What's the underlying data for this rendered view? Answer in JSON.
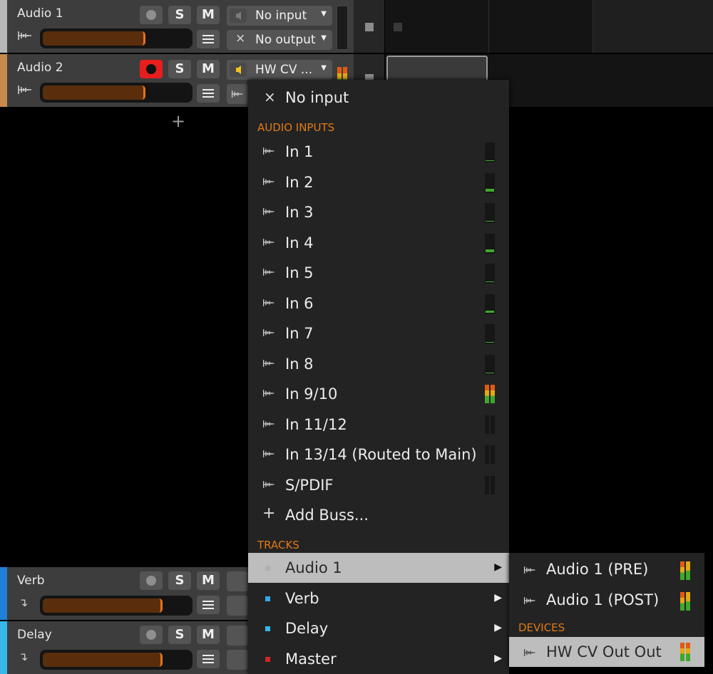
{
  "tracks": [
    {
      "name": "Audio 1",
      "color": "#b7b7b7",
      "volume": 0.66,
      "input": "No input",
      "output": "No output",
      "armed": false,
      "solo": "S",
      "mute": "M"
    },
    {
      "name": "Audio 2",
      "color": "#c58a4b",
      "volume": 0.66,
      "input": "HW CV ...",
      "armed": true,
      "solo": "S",
      "mute": "M"
    },
    {
      "name": "Verb",
      "color": "#1f7fd9",
      "volume": 0.78,
      "solo": "S",
      "mute": "M"
    },
    {
      "name": "Delay",
      "color": "#35b7ea",
      "volume": 0.78,
      "solo": "S",
      "mute": "M"
    }
  ],
  "add_track_glyph": "+",
  "menu": {
    "no_input": "No input",
    "sections": {
      "audio_inputs": "AUDIO INPUTS",
      "tracks": "TRACKS",
      "devices": "DEVICES"
    },
    "audio_inputs": [
      {
        "label": "In 1",
        "meter": "mono",
        "level": 0.0
      },
      {
        "label": "In 2",
        "meter": "mono",
        "level": 0.15
      },
      {
        "label": "In 3",
        "meter": "mono",
        "level": 0.0
      },
      {
        "label": "In 4",
        "meter": "mono",
        "level": 0.15
      },
      {
        "label": "In 5",
        "meter": "mono",
        "level": 0.0
      },
      {
        "label": "In 6",
        "meter": "mono",
        "level": 0.1
      },
      {
        "label": "In 7",
        "meter": "mono",
        "level": 0.0
      },
      {
        "label": "In 8",
        "meter": "mono",
        "level": 0.0
      },
      {
        "label": "In 9/10",
        "meter": "stereo-active"
      },
      {
        "label": "In 11/12",
        "meter": "stereo-idle"
      },
      {
        "label": "In 13/14 (Routed to Main)",
        "meter": "stereo-idle"
      },
      {
        "label": "S/PDIF",
        "meter": "stereo-idle"
      }
    ],
    "add_buss": "Add Buss...",
    "tracks": [
      {
        "label": "Audio 1",
        "color": "#9a9a9a",
        "highlighted": true
      },
      {
        "label": "Verb",
        "color": "#35a6e8"
      },
      {
        "label": "Delay",
        "color": "#35b7ea"
      },
      {
        "label": "Master",
        "color": "#d42424"
      }
    ]
  },
  "submenu": {
    "items": [
      {
        "label": "Audio 1 (PRE)"
      },
      {
        "label": "Audio 1 (POST)"
      }
    ],
    "devices": [
      {
        "label": "HW CV Out Out",
        "highlighted": true
      }
    ]
  },
  "colors": {
    "accent": "#e07a18",
    "meter_green": "#3fa82d",
    "arm_red": "#e81e1e"
  }
}
